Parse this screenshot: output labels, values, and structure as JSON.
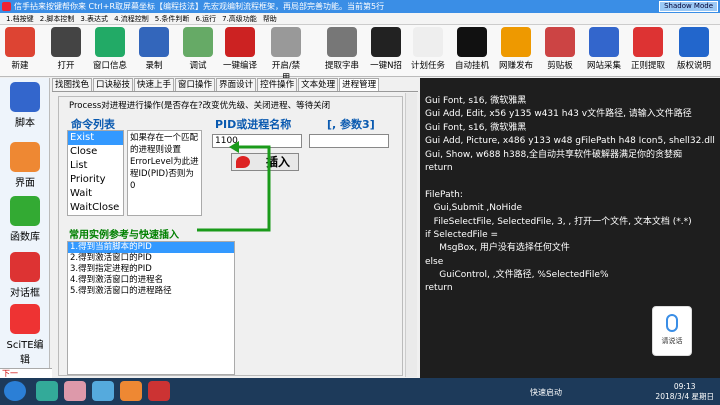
{
  "window": {
    "title": "信手拈来按键帮你来 Ctrl+R取屏幕坐标【编程技法】先宏观编制流程框架，再局部完善功能。当前第5行",
    "mode_button": "Shadow Mode"
  },
  "menu": [
    "1.档按键",
    "2.脚本控制",
    "3.表达式",
    "4.流程控制",
    "5.条件判断",
    "6.运行",
    "7.高级功能",
    "帮助"
  ],
  "toolbar": [
    {
      "label": "新建",
      "icon": "new-icon",
      "color": "#d43"
    },
    {
      "label": "打开",
      "icon": "open-book-icon",
      "color": "#444"
    },
    {
      "label": "窗口信息",
      "icon": "window-info-icon",
      "color": "#2a6"
    },
    {
      "label": "录制",
      "icon": "record-icon",
      "color": "#36b"
    },
    {
      "label": "调试",
      "icon": "debug-icon",
      "color": "#6a6"
    },
    {
      "label": "一键编译",
      "icon": "compile-icon",
      "color": "#c22"
    },
    {
      "label": "开启/禁用",
      "icon": "toggle-icon",
      "color": "#999"
    },
    {
      "label": "提取字串",
      "icon": "extract-string-icon",
      "color": "#777"
    },
    {
      "label": "一键N招",
      "icon": "tricks-icon",
      "color": "#222"
    },
    {
      "label": "计划任务",
      "icon": "clock-icon",
      "color": "#eee"
    },
    {
      "label": "自动挂机",
      "icon": "auto-icon",
      "color": "#111"
    },
    {
      "label": "网赚发布",
      "icon": "publish-icon",
      "color": "#e90"
    },
    {
      "label": "剪贴板",
      "icon": "clipboard-icon",
      "color": "#c44"
    },
    {
      "label": "网站采集",
      "icon": "collect-icon",
      "color": "#36c"
    },
    {
      "label": "正则提取",
      "icon": "regex-icon",
      "color": "#d33"
    },
    {
      "label": "版权说明",
      "icon": "copyright-icon",
      "color": "#26c"
    }
  ],
  "sidebar": [
    {
      "label": "脚本",
      "icon": "script-icon",
      "color": "#36c"
    },
    {
      "label": "界面",
      "icon": "interface-icon",
      "color": "#e83"
    },
    {
      "label": "函数库",
      "icon": "gift-icon",
      "color": "#3a3"
    },
    {
      "label": "对话框",
      "icon": "dialog-icon",
      "color": "#d33"
    },
    {
      "label": "SciTE编辑",
      "icon": "popcorn-icon",
      "color": "#e33"
    }
  ],
  "bottom_text": "下一",
  "tabs": [
    "找图找色",
    "口诀秘技",
    "快速上手",
    "窗口操作",
    "界面设计",
    "控件操作",
    "文本处理",
    "进程管理"
  ],
  "panel": {
    "title": "Process对进程进行操作(是否存在?改变优先级、关闭进程、等待关闭",
    "cmd_label": "命令列表",
    "pid_label": "PID或进程名称",
    "param_label": "[, 参数3]",
    "commands": [
      "Exist",
      "Close",
      "List",
      "Priority",
      "Wait",
      "WaitClose"
    ],
    "description": "如果存在一个匹配的进程则设置ErrorLevel为此进程ID(PID)否则为0",
    "pid_value": "1100",
    "param_value": "",
    "insert_label": "插入",
    "examples_label": "常用实例参考与快速插入",
    "examples": [
      "1.得到当前脚本的PID",
      "2.得到激活窗口的PID",
      "3.得到指定进程的PID",
      "4.得到激活窗口的进程名",
      "5.得到激活窗口的进程路径"
    ]
  },
  "code_lines": [
    "Gui Font, s16, 微软雅黑",
    "Gui Add, Edit, x56 y135 w431 h43 v文件路径, 请输入文件路径",
    "Gui Font, s16, 微软雅黑",
    "Gui Add, Picture, x486 y133 w48 gFilePath h48 Icon5, shell32.dll",
    "Gui, Show, w688 h388,全自动共享软件破解器满足你的贪婪痴",
    "return",
    "",
    "FilePath:",
    "   Gui,Submit ,NoHide",
    "   FileSelectFile, SelectedFile, 3, , 打开一个文件, 文本文档 (*.*)",
    "if SelectedFile =",
    "     MsgBox, 用户没有选择任何文件",
    "else",
    "     GuiControl, ,文件路径, %SelectedFile%",
    "return"
  ],
  "voice": {
    "label": "请说话"
  },
  "taskbar": {
    "tray_text": "快速启动",
    "time": "09:13",
    "date": "2018/3/4 星期日"
  }
}
